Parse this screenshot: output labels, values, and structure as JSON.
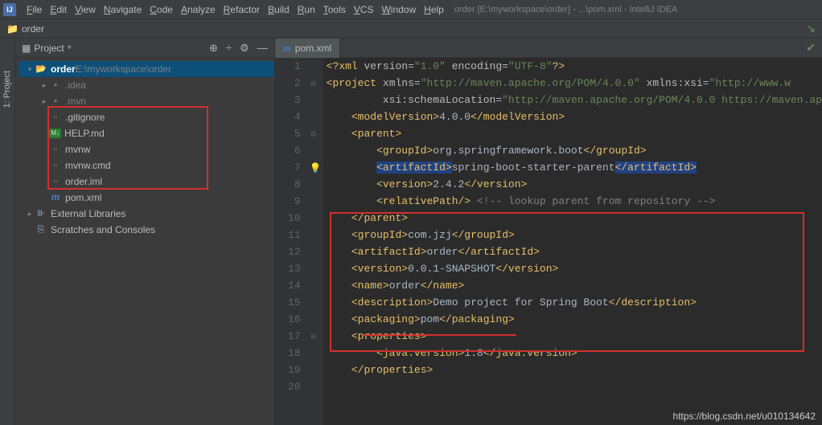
{
  "menubar": {
    "items": [
      "File",
      "Edit",
      "View",
      "Navigate",
      "Code",
      "Analyze",
      "Refactor",
      "Build",
      "Run",
      "Tools",
      "VCS",
      "Window",
      "Help"
    ],
    "path": "order [E:\\myworkspace\\order] - ...\\pom.xml - IntelliJ IDEA"
  },
  "breadcrumb": {
    "project": "order"
  },
  "sidebar": {
    "label": "1: Project"
  },
  "project": {
    "header": "Project",
    "tree": {
      "root": {
        "name": "order",
        "path": "E:\\myworkspace\\order"
      },
      "nodes": [
        {
          "label": ".idea",
          "kind": "folder-dot",
          "indent": 1
        },
        {
          "label": ".mvn",
          "kind": "folder-dot",
          "indent": 1
        },
        {
          "label": ".gitignore",
          "kind": "file",
          "indent": 1
        },
        {
          "label": "HELP.md",
          "kind": "md",
          "indent": 1
        },
        {
          "label": "mvnw",
          "kind": "file",
          "indent": 1
        },
        {
          "label": "mvnw.cmd",
          "kind": "file",
          "indent": 1
        },
        {
          "label": "order.iml",
          "kind": "file",
          "indent": 1
        },
        {
          "label": "pom.xml",
          "kind": "m",
          "indent": 1
        }
      ],
      "libraries": "External Libraries",
      "scratches": "Scratches and Consoles"
    }
  },
  "tab": {
    "label": "pom.xml"
  },
  "code": {
    "lines": [
      {
        "n": 1,
        "html": "<span class=\"pi\">&lt;?</span><span class=\"t\">xml</span> <span class=\"a\">version</span><span class=\"token-eq\">=</span><span class=\"s\">\"1.0\"</span> <span class=\"a\">encoding</span><span class=\"token-eq\">=</span><span class=\"s\">\"UTF-8\"</span><span class=\"pi\">?&gt;</span>"
      },
      {
        "n": 2,
        "html": "<span class=\"t\">&lt;project</span> <span class=\"a\">xmlns</span><span class=\"token-eq\">=</span><span class=\"s\">\"http://maven.apache.org/POM/4.0.0\"</span> <span class=\"a\">xmlns:xsi</span><span class=\"token-eq\">=</span><span class=\"s\">\"http://www.w</span>"
      },
      {
        "n": 3,
        "html": "         <span class=\"a\">xsi:schemaLocation</span><span class=\"token-eq\">=</span><span class=\"s\">\"http://maven.apache.org/POM/4.0.0 https://maven.ap</span>"
      },
      {
        "n": 4,
        "html": "    <span class=\"t\">&lt;modelVersion&gt;</span>4.0.0<span class=\"t\">&lt;/modelVersion&gt;</span>"
      },
      {
        "n": 5,
        "html": "    <span class=\"t\">&lt;parent&gt;</span>"
      },
      {
        "n": 6,
        "html": "        <span class=\"t\">&lt;groupId&gt;</span>org.springframework.boot<span class=\"t\">&lt;/groupId&gt;</span>"
      },
      {
        "n": 7,
        "html": "        <span class=\"hl-bg\"><span class=\"t\">&lt;artifactId&gt;</span></span>spring-boot-starter-parent<span class=\"hl-bg\"><span class=\"t\">&lt;/artifactId&gt;</span></span>"
      },
      {
        "n": 8,
        "html": "        <span class=\"t\">&lt;version&gt;</span>2.4.2<span class=\"t\">&lt;/version&gt;</span>"
      },
      {
        "n": 9,
        "html": "        <span class=\"t\">&lt;relativePath/&gt;</span> <span class=\"c\">&lt;!-- lookup parent from repository --&gt;</span>"
      },
      {
        "n": 10,
        "html": "    <span class=\"t\">&lt;/parent&gt;</span>"
      },
      {
        "n": 11,
        "html": "    <span class=\"t\">&lt;groupId&gt;</span>com.jzj<span class=\"t\">&lt;/groupId&gt;</span>"
      },
      {
        "n": 12,
        "html": "    <span class=\"t\">&lt;artifactId&gt;</span>order<span class=\"t\">&lt;/artifactId&gt;</span>"
      },
      {
        "n": 13,
        "html": "    <span class=\"t\">&lt;version&gt;</span>0.0.1-SNAPSHOT<span class=\"t\">&lt;/version&gt;</span>"
      },
      {
        "n": 14,
        "html": "    <span class=\"t\">&lt;name&gt;</span>order<span class=\"t\">&lt;/name&gt;</span>"
      },
      {
        "n": 15,
        "html": "    <span class=\"t\">&lt;description&gt;</span>Demo project for Spring Boot<span class=\"t\">&lt;/description&gt;</span>"
      },
      {
        "n": 16,
        "html": "    <span class=\"t\">&lt;packaging&gt;</span>pom<span class=\"t\">&lt;/packaging&gt;</span>"
      },
      {
        "n": 17,
        "html": "    <span class=\"t\">&lt;properties&gt;</span>"
      },
      {
        "n": 18,
        "html": "        <span class=\"t\">&lt;java.version&gt;</span>1.8<span class=\"t\">&lt;/java.version&gt;</span>"
      },
      {
        "n": 19,
        "html": "    <span class=\"t\">&lt;/properties&gt;</span>"
      },
      {
        "n": 20,
        "html": ""
      }
    ]
  },
  "watermark": "https://blog.csdn.net/u010134642"
}
